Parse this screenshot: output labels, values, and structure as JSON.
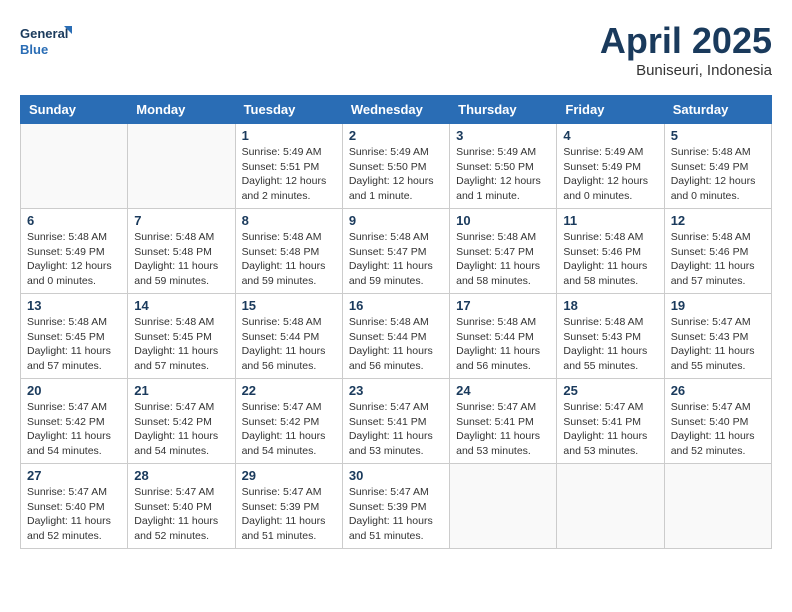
{
  "logo": {
    "line1": "General",
    "line2": "Blue"
  },
  "title": "April 2025",
  "location": "Buniseuri, Indonesia",
  "days_of_week": [
    "Sunday",
    "Monday",
    "Tuesday",
    "Wednesday",
    "Thursday",
    "Friday",
    "Saturday"
  ],
  "weeks": [
    [
      {
        "day": "",
        "info": ""
      },
      {
        "day": "",
        "info": ""
      },
      {
        "day": "1",
        "info": "Sunrise: 5:49 AM\nSunset: 5:51 PM\nDaylight: 12 hours\nand 2 minutes."
      },
      {
        "day": "2",
        "info": "Sunrise: 5:49 AM\nSunset: 5:50 PM\nDaylight: 12 hours\nand 1 minute."
      },
      {
        "day": "3",
        "info": "Sunrise: 5:49 AM\nSunset: 5:50 PM\nDaylight: 12 hours\nand 1 minute."
      },
      {
        "day": "4",
        "info": "Sunrise: 5:49 AM\nSunset: 5:49 PM\nDaylight: 12 hours\nand 0 minutes."
      },
      {
        "day": "5",
        "info": "Sunrise: 5:48 AM\nSunset: 5:49 PM\nDaylight: 12 hours\nand 0 minutes."
      }
    ],
    [
      {
        "day": "6",
        "info": "Sunrise: 5:48 AM\nSunset: 5:49 PM\nDaylight: 12 hours\nand 0 minutes."
      },
      {
        "day": "7",
        "info": "Sunrise: 5:48 AM\nSunset: 5:48 PM\nDaylight: 11 hours\nand 59 minutes."
      },
      {
        "day": "8",
        "info": "Sunrise: 5:48 AM\nSunset: 5:48 PM\nDaylight: 11 hours\nand 59 minutes."
      },
      {
        "day": "9",
        "info": "Sunrise: 5:48 AM\nSunset: 5:47 PM\nDaylight: 11 hours\nand 59 minutes."
      },
      {
        "day": "10",
        "info": "Sunrise: 5:48 AM\nSunset: 5:47 PM\nDaylight: 11 hours\nand 58 minutes."
      },
      {
        "day": "11",
        "info": "Sunrise: 5:48 AM\nSunset: 5:46 PM\nDaylight: 11 hours\nand 58 minutes."
      },
      {
        "day": "12",
        "info": "Sunrise: 5:48 AM\nSunset: 5:46 PM\nDaylight: 11 hours\nand 57 minutes."
      }
    ],
    [
      {
        "day": "13",
        "info": "Sunrise: 5:48 AM\nSunset: 5:45 PM\nDaylight: 11 hours\nand 57 minutes."
      },
      {
        "day": "14",
        "info": "Sunrise: 5:48 AM\nSunset: 5:45 PM\nDaylight: 11 hours\nand 57 minutes."
      },
      {
        "day": "15",
        "info": "Sunrise: 5:48 AM\nSunset: 5:44 PM\nDaylight: 11 hours\nand 56 minutes."
      },
      {
        "day": "16",
        "info": "Sunrise: 5:48 AM\nSunset: 5:44 PM\nDaylight: 11 hours\nand 56 minutes."
      },
      {
        "day": "17",
        "info": "Sunrise: 5:48 AM\nSunset: 5:44 PM\nDaylight: 11 hours\nand 56 minutes."
      },
      {
        "day": "18",
        "info": "Sunrise: 5:48 AM\nSunset: 5:43 PM\nDaylight: 11 hours\nand 55 minutes."
      },
      {
        "day": "19",
        "info": "Sunrise: 5:47 AM\nSunset: 5:43 PM\nDaylight: 11 hours\nand 55 minutes."
      }
    ],
    [
      {
        "day": "20",
        "info": "Sunrise: 5:47 AM\nSunset: 5:42 PM\nDaylight: 11 hours\nand 54 minutes."
      },
      {
        "day": "21",
        "info": "Sunrise: 5:47 AM\nSunset: 5:42 PM\nDaylight: 11 hours\nand 54 minutes."
      },
      {
        "day": "22",
        "info": "Sunrise: 5:47 AM\nSunset: 5:42 PM\nDaylight: 11 hours\nand 54 minutes."
      },
      {
        "day": "23",
        "info": "Sunrise: 5:47 AM\nSunset: 5:41 PM\nDaylight: 11 hours\nand 53 minutes."
      },
      {
        "day": "24",
        "info": "Sunrise: 5:47 AM\nSunset: 5:41 PM\nDaylight: 11 hours\nand 53 minutes."
      },
      {
        "day": "25",
        "info": "Sunrise: 5:47 AM\nSunset: 5:41 PM\nDaylight: 11 hours\nand 53 minutes."
      },
      {
        "day": "26",
        "info": "Sunrise: 5:47 AM\nSunset: 5:40 PM\nDaylight: 11 hours\nand 52 minutes."
      }
    ],
    [
      {
        "day": "27",
        "info": "Sunrise: 5:47 AM\nSunset: 5:40 PM\nDaylight: 11 hours\nand 52 minutes."
      },
      {
        "day": "28",
        "info": "Sunrise: 5:47 AM\nSunset: 5:40 PM\nDaylight: 11 hours\nand 52 minutes."
      },
      {
        "day": "29",
        "info": "Sunrise: 5:47 AM\nSunset: 5:39 PM\nDaylight: 11 hours\nand 51 minutes."
      },
      {
        "day": "30",
        "info": "Sunrise: 5:47 AM\nSunset: 5:39 PM\nDaylight: 11 hours\nand 51 minutes."
      },
      {
        "day": "",
        "info": ""
      },
      {
        "day": "",
        "info": ""
      },
      {
        "day": "",
        "info": ""
      }
    ]
  ]
}
